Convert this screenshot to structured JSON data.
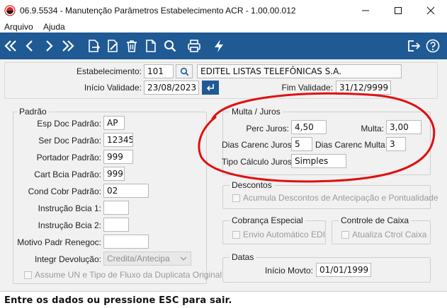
{
  "window": {
    "title": "06.9.5534 - Manutenção Parâmetros Estabelecimento ACR - 1.00.00.012"
  },
  "menu": {
    "items": [
      "Arquivo",
      "Ajuda"
    ]
  },
  "toolbar": {
    "icons": [
      "first-icon",
      "previous-icon",
      "next-icon",
      "last-icon",
      "goto-icon",
      "edit-icon",
      "delete-icon",
      "new-document-icon",
      "search-icon",
      "print-icon",
      "execute-icon",
      "exit-icon",
      "help-icon"
    ]
  },
  "header": {
    "estabelecimento_label": "Estabelecimento:",
    "estabelecimento_code": "101",
    "estabelecimento_name": "EDITEL LISTAS TELEFÔNICAS S.A.",
    "inicio_validade_label": "Início Validade:",
    "inicio_validade": "23/08/2023",
    "fim_validade_label": "Fim Validade:",
    "fim_validade": "31/12/9999"
  },
  "padrao": {
    "title": "Padrão",
    "esp_doc_label": "Esp Doc Padrão:",
    "esp_doc": "AP",
    "ser_doc_label": "Ser Doc Padrão:",
    "ser_doc": "12345",
    "portador_label": "Portador Padrão:",
    "portador": "999",
    "cart_bcia_label": "Cart Bcia Padrão:",
    "cart_bcia": "999",
    "cond_cobr_label": "Cond Cobr Padrão:",
    "cond_cobr": "02",
    "instr_bcia1_label": "Instrução Bcia 1:",
    "instr_bcia1": "",
    "instr_bcia2_label": "Instrução Bcia 2:",
    "instr_bcia2": "",
    "motivo_label": "Motivo Padr Renegoc:",
    "motivo": "",
    "integr_label": "Integr Devolução:",
    "integr": "Credita/Antecipa",
    "assume_un_label": "Assume UN e Tipo de Fluxo da Duplicata Original"
  },
  "multa_juros": {
    "title": "Multa / Juros",
    "perc_juros_label": "Perc Juros:",
    "perc_juros": "4,50",
    "multa_label": "Multa:",
    "multa": "3,00",
    "dias_carenc_juros_label": "Dias Carenc Juros:",
    "dias_carenc_juros": "5",
    "dias_carenc_multa_label": "Dias Carenc Multa:",
    "dias_carenc_multa": "3",
    "tipo_calculo_label": "Tipo Cálculo Juros:",
    "tipo_calculo": "Simples"
  },
  "descontos": {
    "title": "Descontos",
    "acumula_label": "Acumula Descontos de Antecipação e Pontualidade"
  },
  "cobranca": {
    "title": "Cobrança Especial",
    "envio_label": "Envio Automático EDI"
  },
  "caixa": {
    "title": "Controle de Caixa",
    "atualiza_label": "Atualiza Ctrol Caixa"
  },
  "datas": {
    "title": "Datas",
    "inicio_movto_label": "Início Movto:",
    "inicio_movto": "01/01/1999"
  },
  "status": {
    "text": "Entre os dados ou pressione ESC para sair."
  },
  "colors": {
    "toolbar": "#1f5a95",
    "annotation": "#e01010"
  }
}
